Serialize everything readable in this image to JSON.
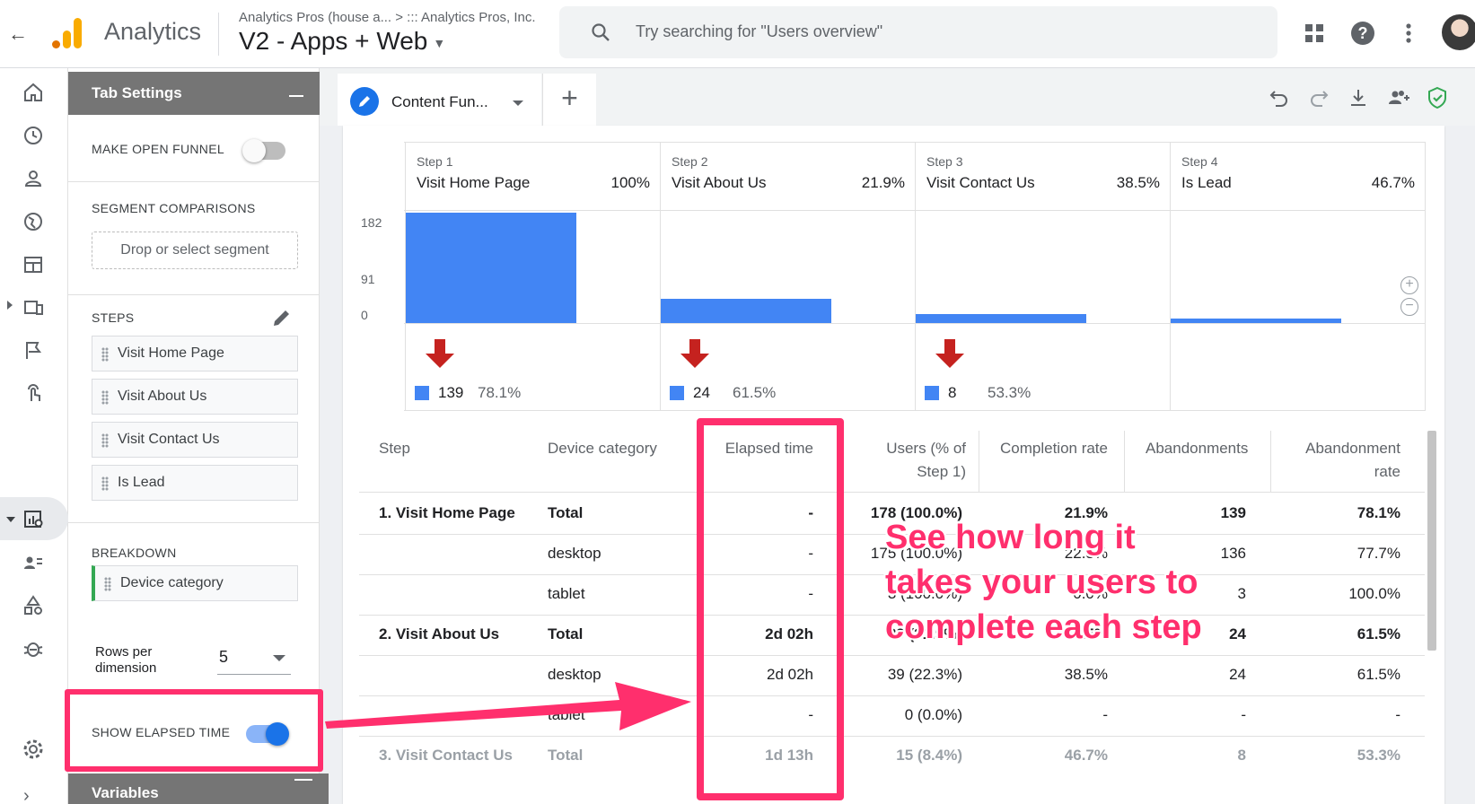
{
  "header": {
    "back_icon": "arrow-left-icon",
    "brand": "Analytics",
    "account_breadcrumb": "Analytics Pros (house a...  >  ::: Analytics Pros, Inc.",
    "property": "V2 - Apps + Web",
    "search_placeholder": "Try searching for \"Users overview\"",
    "icons": [
      "apps-icon",
      "help-icon",
      "more-vert-icon",
      "avatar"
    ]
  },
  "leftnav": {
    "icons": [
      "home-icon",
      "clock-icon",
      "person-icon",
      "globe-icon",
      "table-icon",
      "devices-icon",
      "flag-icon",
      "touch-icon",
      "analysis-icon",
      "audience-icon",
      "shapes-icon",
      "bug-icon",
      "settings-icon",
      "expand-icon"
    ]
  },
  "tab_settings": {
    "title": "Tab Settings",
    "make_open_funnel": "MAKE OPEN FUNNEL",
    "segment_comparisons": "SEGMENT COMPARISONS",
    "segment_placeholder": "Drop or select segment",
    "steps_label": "STEPS",
    "steps": [
      "Visit Home Page",
      "Visit About Us",
      "Visit Contact Us",
      "Is Lead"
    ],
    "breakdown_label": "BREAKDOWN",
    "breakdown_value": "Device category",
    "rows_per_dimension_label": "Rows per dimension",
    "rows_per_dimension_value": "5",
    "show_elapsed_time": "SHOW ELAPSED TIME",
    "variables": "Variables",
    "open_funnel_on": false,
    "elapsed_time_on": true
  },
  "tabs": {
    "active": "Content Fun...",
    "add": "+"
  },
  "toolbar_icons": [
    "undo-icon",
    "redo-icon",
    "download-icon",
    "share-icon",
    "shield-check-icon"
  ],
  "colors": {
    "accent": "#4285f4",
    "brand_orange": "#f9ab00",
    "brand_dark_orange": "#e37400",
    "annotation": "#ff2f6d",
    "drop_arrow": "#c5221f",
    "shield_green": "#34a853"
  },
  "chart_data": {
    "type": "bar",
    "categories": [
      "Visit Home Page",
      "Visit About Us",
      "Visit Contact Us",
      "Is Lead"
    ],
    "step_numbers": [
      "Step 1",
      "Step 2",
      "Step 3",
      "Step 4"
    ],
    "step_percents": [
      "100%",
      "21.9%",
      "38.5%",
      "46.7%"
    ],
    "values": [
      178,
      39,
      15,
      7
    ],
    "ylim": [
      0,
      182
    ],
    "yticks": [
      "182",
      "91",
      "0"
    ],
    "abandonments": [
      {
        "count": "139",
        "rate": "78.1%"
      },
      {
        "count": "24",
        "rate": "61.5%"
      },
      {
        "count": "8",
        "rate": "53.3%"
      }
    ]
  },
  "table": {
    "headers": [
      "Step",
      "Device category",
      "Elapsed time",
      "Users (% of Step 1)",
      "Completion rate",
      "Abandonments",
      "Abandonment rate"
    ],
    "rows": [
      {
        "step": "1. Visit Home Page",
        "device": "Total",
        "elapsed": "-",
        "users": "178 (100.0%)",
        "completion": "21.9%",
        "abandonments": "139",
        "abandon_rate": "78.1%",
        "bold": true
      },
      {
        "step": "",
        "device": "desktop",
        "elapsed": "-",
        "users": "175 (100.0%)",
        "completion": "22.3%",
        "abandonments": "136",
        "abandon_rate": "77.7%"
      },
      {
        "step": "",
        "device": "tablet",
        "elapsed": "-",
        "users": "3 (100.0%)",
        "completion": "0.0%",
        "abandonments": "3",
        "abandon_rate": "100.0%"
      },
      {
        "step": "2. Visit About Us",
        "device": "Total",
        "elapsed": "2d 02h",
        "users": "39 (21.9%)",
        "completion": "38.5%",
        "abandonments": "24",
        "abandon_rate": "61.5%",
        "bold": true
      },
      {
        "step": "",
        "device": "desktop",
        "elapsed": "2d 02h",
        "users": "39 (22.3%)",
        "completion": "38.5%",
        "abandonments": "24",
        "abandon_rate": "61.5%"
      },
      {
        "step": "",
        "device": "tablet",
        "elapsed": "-",
        "users": "0 (0.0%)",
        "completion": "-",
        "abandonments": "-",
        "abandon_rate": "-"
      },
      {
        "step": "3. Visit Contact Us",
        "device": "Total",
        "elapsed": "1d 13h",
        "users": "15 (8.4%)",
        "completion": "46.7%",
        "abandonments": "8",
        "abandon_rate": "53.3%",
        "bold": true,
        "faded": true
      }
    ]
  },
  "annotation": {
    "callout_lines": [
      "See how long it",
      "takes your users to",
      "complete each step"
    ]
  }
}
